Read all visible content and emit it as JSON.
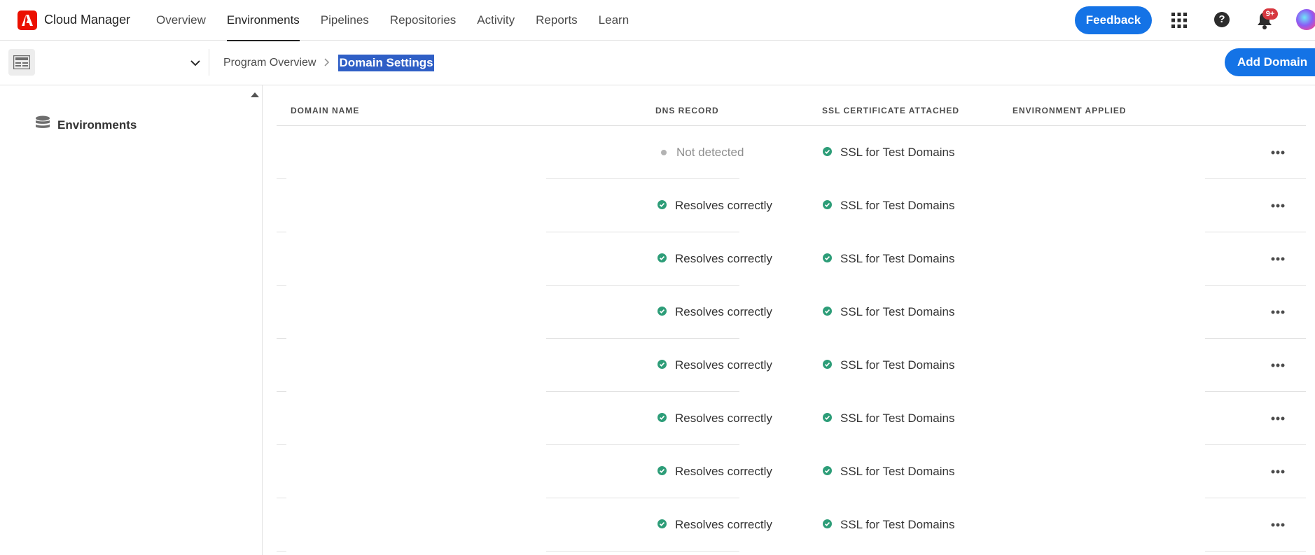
{
  "app": {
    "title": "Cloud Manager",
    "logo_icon": "adobe-logo-icon",
    "brand_color": "#eb1000"
  },
  "nav": {
    "items": [
      {
        "label": "Overview",
        "active": false
      },
      {
        "label": "Environments",
        "active": true
      },
      {
        "label": "Pipelines",
        "active": false
      },
      {
        "label": "Repositories",
        "active": false
      },
      {
        "label": "Activity",
        "active": false
      },
      {
        "label": "Reports",
        "active": false
      },
      {
        "label": "Learn",
        "active": false
      }
    ],
    "feedback_label": "Feedback",
    "notifications_badge": "9+",
    "accent_color": "#1473e6"
  },
  "subbar": {
    "breadcrumb": [
      "Program Overview",
      "Domain Settings"
    ],
    "add_domain_label": "Add Domain"
  },
  "sidebar": {
    "items": [
      {
        "label": "Environments",
        "icon": "database-icon"
      }
    ]
  },
  "table": {
    "headers": {
      "domain_name": "DOMAIN NAME",
      "dns_record": "DNS RECORD",
      "ssl_certificate": "SSL CERTIFICATE ATTACHED",
      "environment_applied": "ENVIRONMENT APPLIED"
    },
    "rows": [
      {
        "domain_name": "",
        "dns": "Not detected",
        "dns_status": "unknown",
        "ssl": "SSL for Test Domains",
        "environment": ""
      },
      {
        "domain_name": "",
        "dns": "Resolves correctly",
        "dns_status": "ok",
        "ssl": "SSL for Test Domains",
        "environment": ""
      },
      {
        "domain_name": "",
        "dns": "Resolves correctly",
        "dns_status": "ok",
        "ssl": "SSL for Test Domains",
        "environment": ""
      },
      {
        "domain_name": "",
        "dns": "Resolves correctly",
        "dns_status": "ok",
        "ssl": "SSL for Test Domains",
        "environment": ""
      },
      {
        "domain_name": "",
        "dns": "Resolves correctly",
        "dns_status": "ok",
        "ssl": "SSL for Test Domains",
        "environment": ""
      },
      {
        "domain_name": "",
        "dns": "Resolves correctly",
        "dns_status": "ok",
        "ssl": "SSL for Test Domains",
        "environment": ""
      },
      {
        "domain_name": "",
        "dns": "Resolves correctly",
        "dns_status": "ok",
        "ssl": "SSL for Test Domains",
        "environment": ""
      },
      {
        "domain_name": "",
        "dns": "Resolves correctly",
        "dns_status": "ok",
        "ssl": "SSL for Test Domains",
        "environment": ""
      }
    ],
    "status_ok_color": "#2d9d78"
  }
}
